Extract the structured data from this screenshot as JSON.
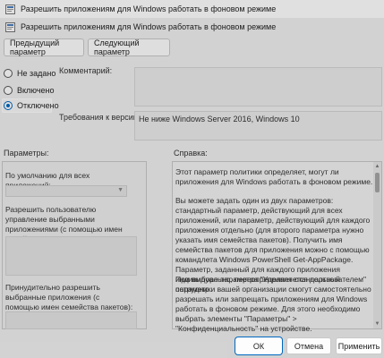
{
  "window": {
    "title": "Разрешить приложениям для Windows работать в фоновом режиме",
    "subtitle": "Разрешить приложениям для Windows работать в фоновом режиме"
  },
  "nav": {
    "prev_label": "Предыдущий параметр",
    "next_label": "Следующий параметр"
  },
  "state": {
    "options": [
      {
        "label": "Не задано",
        "checked": false
      },
      {
        "label": "Включено",
        "checked": false
      },
      {
        "label": "Отключено",
        "checked": true
      }
    ]
  },
  "comment": {
    "label": "Комментарий:",
    "value": ""
  },
  "requirements": {
    "label": "Требования к версии:",
    "value": "Не ниже Windows Server 2016, Windows 10"
  },
  "sections": {
    "params_label": "Параметры:",
    "help_label": "Справка:"
  },
  "params": {
    "default_label": "По умолчанию для всех приложений:",
    "allow_user_label": "Разрешить пользователю управление выбранными приложениями (с помощью имен семейства пакетов):",
    "force_allow_label": "Принудительно разрешить выбранные приложения (с помощью имен семейства пакетов):"
  },
  "help": {
    "p1": "Этот параметр политики определяет, могут ли приложения для Windows работать в фоновом режиме.",
    "p2": "Вы можете задать один из двух параметров: стандартный параметр, действующий для всех приложений, или параметр, действующий для каждого приложения отдельно (для второго параметра нужно указать имя семейства пакетов). Получить имя семейства пакетов для приложения можно с помощью командлета Windows PowerShell Get-AppPackage. Параметр, заданный для каждого приложения индивидуально, переопределяет стандартный параметр.",
    "p3": "При выборе параметра \"Управляется пользователем\" сотрудники вашей организации смогут самостоятельно разрешать или запрещать приложениям для Windows работать в фоновом режиме. Для этого необходимо выбрать элементы \"Параметры\" > \"Конфиденциальность\" на устройстве."
  },
  "footer": {
    "ok_label": "ОК",
    "cancel_label": "Отмена",
    "apply_label": "Применить"
  },
  "colors": {
    "accent": "#0067c0",
    "window_bg": "#f0f0f0"
  }
}
